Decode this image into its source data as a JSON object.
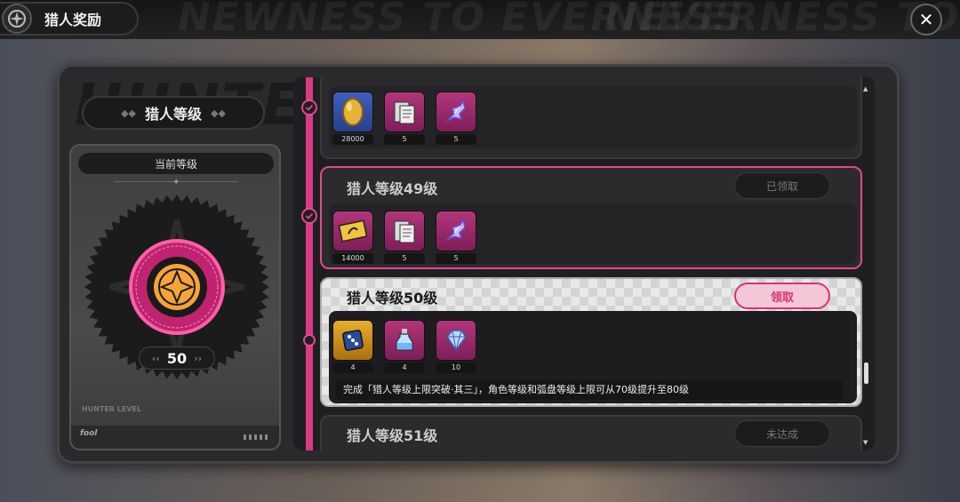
{
  "header": {
    "title": "猎人奖励",
    "bg_text_1": "NEWNESS TO EVERNESS",
    "bg_text_2": "NEVERNESS TO"
  },
  "left_panel": {
    "watermark": "HUNTER",
    "level_label": "猎人等级",
    "current_level_label": "当前等级",
    "current_level": "50",
    "card_footer_text": "HUNTER LEVEL"
  },
  "rewards": [
    {
      "title": "",
      "status": "",
      "status_type": "claimed",
      "items": [
        {
          "icon": "gold-egg-icon",
          "count": "28000",
          "bg": "blue"
        },
        {
          "icon": "document-card-icon",
          "count": "5",
          "bg": "pink"
        },
        {
          "icon": "crystal-shard-icon",
          "count": "5",
          "bg": "pink"
        }
      ]
    },
    {
      "title": "猎人等级49级",
      "status": "已领取",
      "status_type": "claimed",
      "items": [
        {
          "icon": "gold-ticket-icon",
          "count": "14000",
          "bg": "pink"
        },
        {
          "icon": "document-card-icon",
          "count": "5",
          "bg": "pink"
        },
        {
          "icon": "crystal-shard-icon",
          "count": "5",
          "bg": "pink"
        }
      ]
    },
    {
      "title": "猎人等级50级",
      "status": "领取",
      "status_type": "claimable",
      "description": "完成「猎人等级上限突破·其三」，角色等级和弧盘等级上限可从70级提升至80级",
      "items": [
        {
          "icon": "dice-icon",
          "count": "4",
          "bg": "gold"
        },
        {
          "icon": "potion-bottle-icon",
          "count": "4",
          "bg": "pink"
        },
        {
          "icon": "diamond-gem-icon",
          "count": "10",
          "bg": "pink"
        }
      ]
    },
    {
      "title": "猎人等级51级",
      "status": "未达成",
      "status_type": "locked",
      "items": []
    }
  ],
  "colors": {
    "accent_pink": "#e0498f",
    "claimable_text": "#d8336f"
  }
}
